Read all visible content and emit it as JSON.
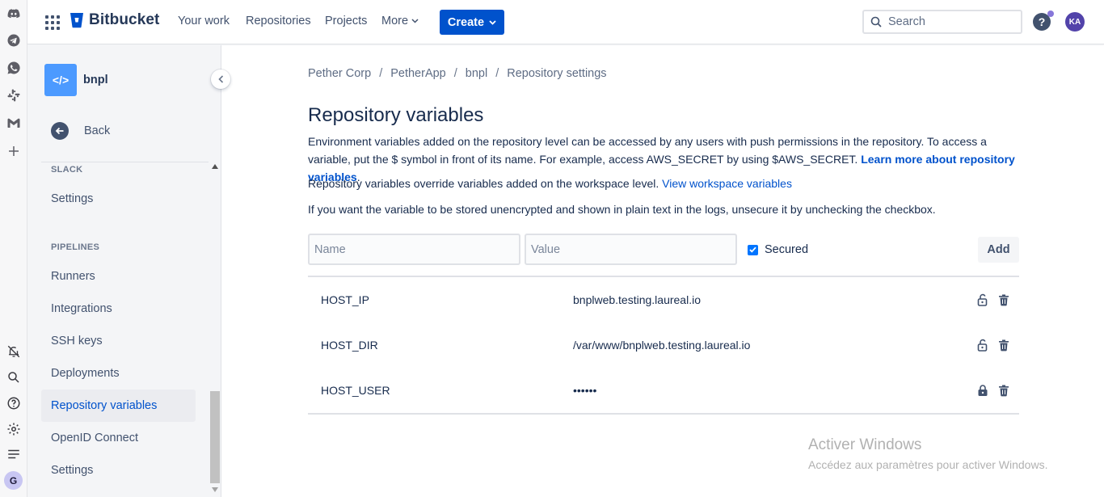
{
  "extensions": {
    "icons": [
      "discord-icon",
      "telegram-icon",
      "whatsapp-icon",
      "slack-icon",
      "gmail-icon",
      "add-icon",
      "notifications-off-icon",
      "search-icon",
      "help-icon",
      "settings-icon",
      "menu-icon"
    ],
    "profile_initial": "G"
  },
  "topnav": {
    "logo_text": "Bitbucket",
    "items": [
      "Your work",
      "Repositories",
      "Projects"
    ],
    "more_label": "More",
    "create_label": "Create",
    "search_placeholder": "Search",
    "help_label": "?",
    "avatar_initials": "KA",
    "accent": "#0052cc"
  },
  "sidebar": {
    "repo_icon": "</>",
    "repo_name": "bnpl",
    "back_label": "Back",
    "sections": [
      {
        "title": "SLACK",
        "items": [
          "Settings"
        ]
      },
      {
        "title": "PIPELINES",
        "items": [
          "Runners",
          "Integrations",
          "SSH keys",
          "Deployments",
          "Repository variables",
          "OpenID Connect",
          "Settings"
        ]
      }
    ],
    "active_item": "Repository variables"
  },
  "main": {
    "breadcrumb": [
      "Pether Corp",
      "PetherApp",
      "bnpl",
      "Repository settings"
    ],
    "title": "Repository variables",
    "para1": "Environment variables added on the repository level can be accessed by any users with push permissions in the repository. To access a variable, put the $ symbol in front of its name. For example, access AWS_SECRET by using $AWS_SECRET.",
    "para1_link": "Learn more about repository variables",
    "para1_end": ".",
    "para2": "Repository variables override variables added on the workspace level.",
    "para2_link": "View workspace variables",
    "para3": "If you want the variable to be stored unencrypted and shown in plain text in the logs, unsecure it by unchecking the checkbox.",
    "form": {
      "name_placeholder": "Name",
      "value_placeholder": "Value",
      "secured_label": "Secured",
      "secured_checked": true,
      "add_label": "Add"
    },
    "variables": [
      {
        "name": "HOST_IP",
        "value": "bnplweb.testing.laureal.io",
        "secured": false
      },
      {
        "name": "HOST_DIR",
        "value": "/var/www/bnplweb.testing.laureal.io",
        "secured": false
      },
      {
        "name": "HOST_USER",
        "value": "••••••",
        "secured": true
      }
    ]
  },
  "watermark": {
    "line1": "Activer Windows",
    "line2": "Accédez aux paramètres pour activer Windows."
  }
}
